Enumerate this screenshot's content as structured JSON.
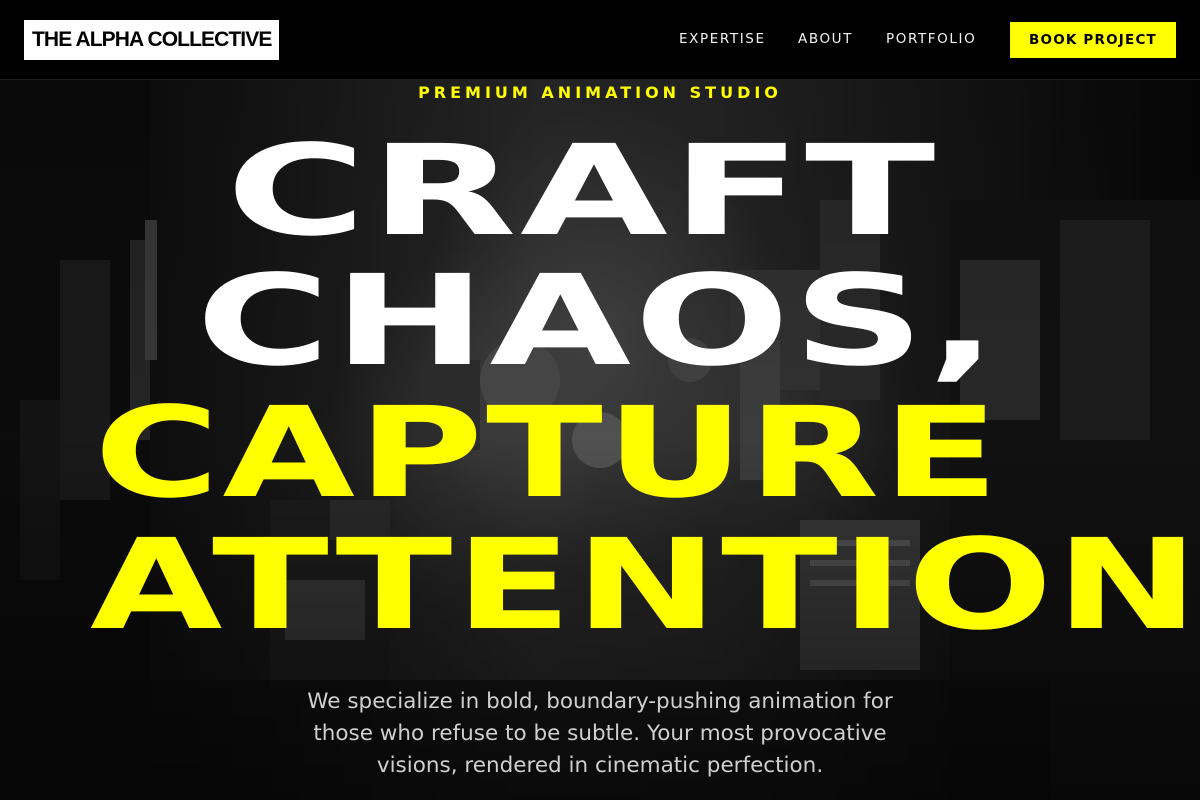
{
  "header": {
    "logo": "THE ALPHA COLLECTIVE",
    "nav": [
      {
        "label": "EXPERTISE"
      },
      {
        "label": "ABOUT"
      },
      {
        "label": "PORTFOLIO"
      }
    ],
    "cta_label": "BOOK PROJECT"
  },
  "hero": {
    "eyebrow": "PREMIUM ANIMATION STUDIO",
    "headline_lines": [
      "CRAFT",
      "CHAOS,",
      "CAPTURE",
      "ATTENTION"
    ],
    "description": "We specialize in bold, boundary-pushing animation for those who refuse to be subtle. Your most provocative visions, rendered in cinematic perfection."
  },
  "colors": {
    "accent": "#ffff00",
    "background": "#000000",
    "headline_primary": "#ffffff",
    "text_muted": "#cfcfcf"
  }
}
